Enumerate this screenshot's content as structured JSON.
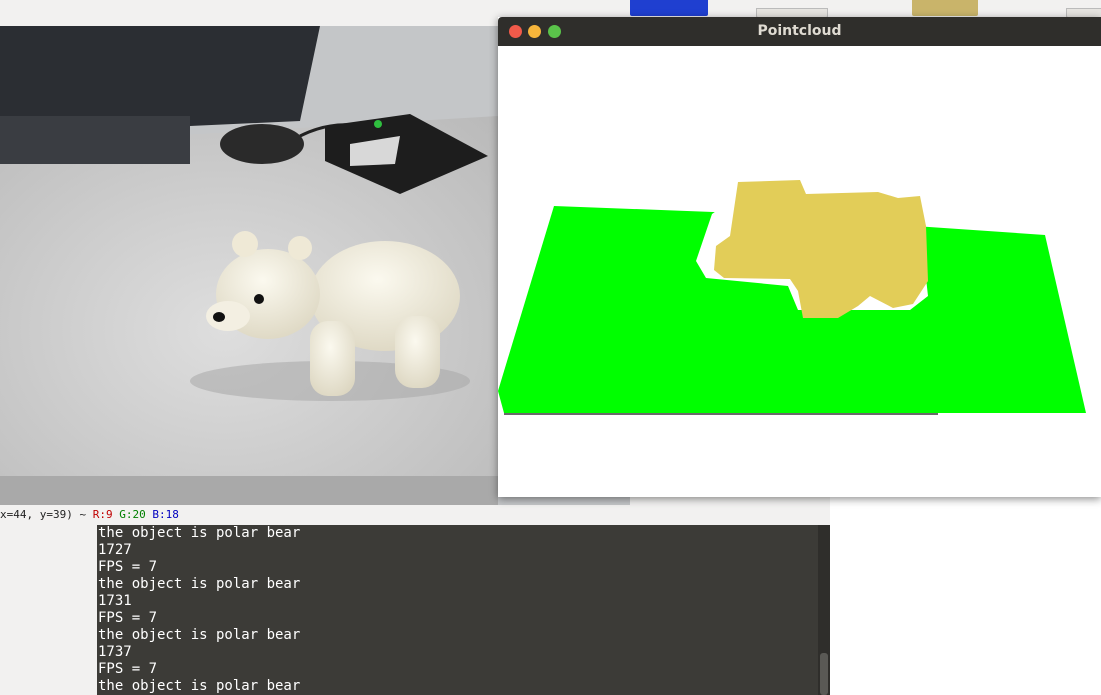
{
  "camera_window": {
    "status_bar": {
      "coords": "x=44, y=39) ~",
      "r": "R:9",
      "g": "G:20",
      "b": "B:18"
    }
  },
  "pointcloud_window": {
    "title": "Pointcloud",
    "colors": {
      "plane": "#00ff00",
      "object": "#e2cd58",
      "background": "#ffffff",
      "titlebar": "#2f2e2b"
    }
  },
  "terminal": {
    "lines": [
      "the object is polar bear",
      "1727",
      "FPS = 7",
      "the object is polar bear",
      "1731",
      "FPS = 7",
      "the object is polar bear",
      "1737",
      "FPS = 7",
      "the object is polar bear"
    ]
  }
}
